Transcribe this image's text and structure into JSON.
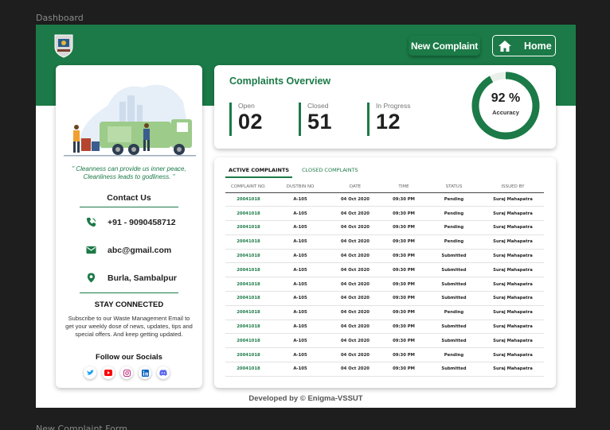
{
  "frame": {
    "top_label": "Dashboard",
    "bottom_label": "New Complaint Form"
  },
  "header": {
    "new_complaint_label": "New Complaint",
    "home_label": "Home"
  },
  "left_panel": {
    "quote": "\" Cleanness can provide us inner peace, Cleanliness leads to godliness. \"",
    "contact_title": "Contact Us",
    "phone": "+91 - 9090458712",
    "email": "abc@gmail.com",
    "location": "Burla, Sambalpur",
    "stay_title": "STAY CONNECTED",
    "subscribe_text": "Subscribe to our Waste Management Email to get your weekly dose of news, updates, tips and special offers. And keep getting updated.",
    "follow_title": "Follow our Socials",
    "socials": [
      "twitter-icon",
      "youtube-icon",
      "instagram-icon",
      "linkedin-icon",
      "discord-icon"
    ]
  },
  "overview": {
    "title": "Complaints Overview",
    "open_label": "Open",
    "open_value": "02",
    "closed_label": "Closed",
    "closed_value": "51",
    "progress_label": "In Progress",
    "progress_value": "12",
    "accuracy_value": "92 %",
    "accuracy_label": "Accuracy",
    "accuracy_fraction": 0.92
  },
  "complaints": {
    "tab_active": "ACTIVE COMPLAINTS",
    "tab_closed": "CLOSED COMPLAINTS",
    "columns": [
      "COMPLAINT NO.",
      "DUSTBIN NO",
      "DATE",
      "TIME",
      "STATUS",
      "ISSUED BY"
    ],
    "rows": [
      [
        "20041018",
        "A-105",
        "04 Oct 2020",
        "09:30 PM",
        "Pending",
        "Suraj Mahapatra"
      ],
      [
        "20041018",
        "A-105",
        "04 Oct 2020",
        "09:30 PM",
        "Pending",
        "Suraj Mahapatra"
      ],
      [
        "20041018",
        "A-105",
        "04 Oct 2020",
        "09:30 PM",
        "Pending",
        "Suraj Mahapatra"
      ],
      [
        "20041018",
        "A-105",
        "04 Oct 2020",
        "09:30 PM",
        "Pending",
        "Suraj Mahapatra"
      ],
      [
        "20041018",
        "A-105",
        "04 Oct 2020",
        "09:30 PM",
        "Submitted",
        "Suraj Mahapatra"
      ],
      [
        "20041018",
        "A-105",
        "04 Oct 2020",
        "09:30 PM",
        "Submitted",
        "Suraj Mahapatra"
      ],
      [
        "20041018",
        "A-105",
        "04 Oct 2020",
        "09:30 PM",
        "Submitted",
        "Suraj Mahapatra"
      ],
      [
        "20041018",
        "A-105",
        "04 Oct 2020",
        "09:30 PM",
        "Submitted",
        "Suraj Mahapatra"
      ],
      [
        "20041018",
        "A-105",
        "04 Oct 2020",
        "09:30 PM",
        "Pending",
        "Suraj Mahapatra"
      ],
      [
        "20041018",
        "A-105",
        "04 Oct 2020",
        "09:30 PM",
        "Submitted",
        "Suraj Mahapatra"
      ],
      [
        "20041018",
        "A-105",
        "04 Oct 2020",
        "09:30 PM",
        "Submitted",
        "Suraj Mahapatra"
      ],
      [
        "20041018",
        "A-105",
        "04 Oct 2020",
        "09:30 PM",
        "Pending",
        "Suraj Mahapatra"
      ],
      [
        "20041018",
        "A-105",
        "04 Oct 2020",
        "09:30 PM",
        "Submitted",
        "Suraj Mahapatra"
      ]
    ]
  },
  "footer": "Developed by © Enigma-VSSUT",
  "colors": {
    "brand_green": "#1b7a47",
    "background": "#1e1e1e"
  }
}
